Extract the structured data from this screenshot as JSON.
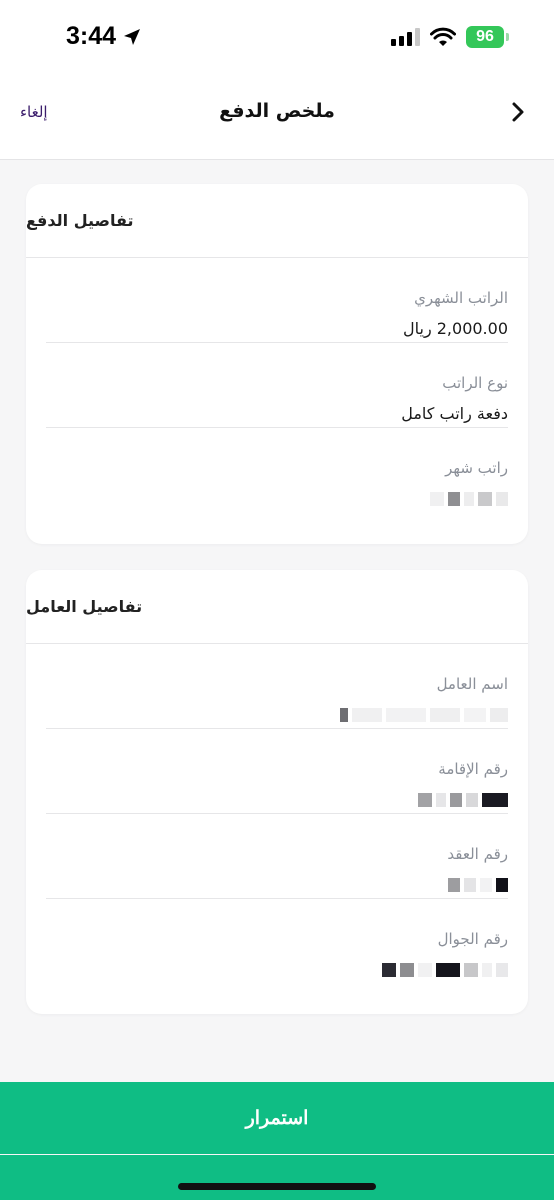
{
  "status": {
    "time": "3:44",
    "battery": "96"
  },
  "nav": {
    "title": "ملخص الدفع",
    "cancel": "إلغاء"
  },
  "payment": {
    "title": "تفاصيل الدفع",
    "rows": [
      {
        "label": "الراتب الشهري",
        "value": "2,000.00 ريال"
      },
      {
        "label": "نوع الراتب",
        "value": "دفعة راتب كامل"
      },
      {
        "label": "راتب شهر",
        "value": ""
      }
    ]
  },
  "worker": {
    "title": "تفاصيل العامل",
    "rows": [
      {
        "label": "اسم العامل",
        "value": ""
      },
      {
        "label": "رقم الإقامة",
        "value": ""
      },
      {
        "label": "رقم العقد",
        "value": ""
      },
      {
        "label": "رقم الجوال",
        "value": ""
      }
    ]
  },
  "actions": {
    "continue": "استمرار"
  },
  "colors": {
    "accent": "#0fbd84",
    "battery": "#34c759",
    "cancel": "#3b1c6b"
  }
}
